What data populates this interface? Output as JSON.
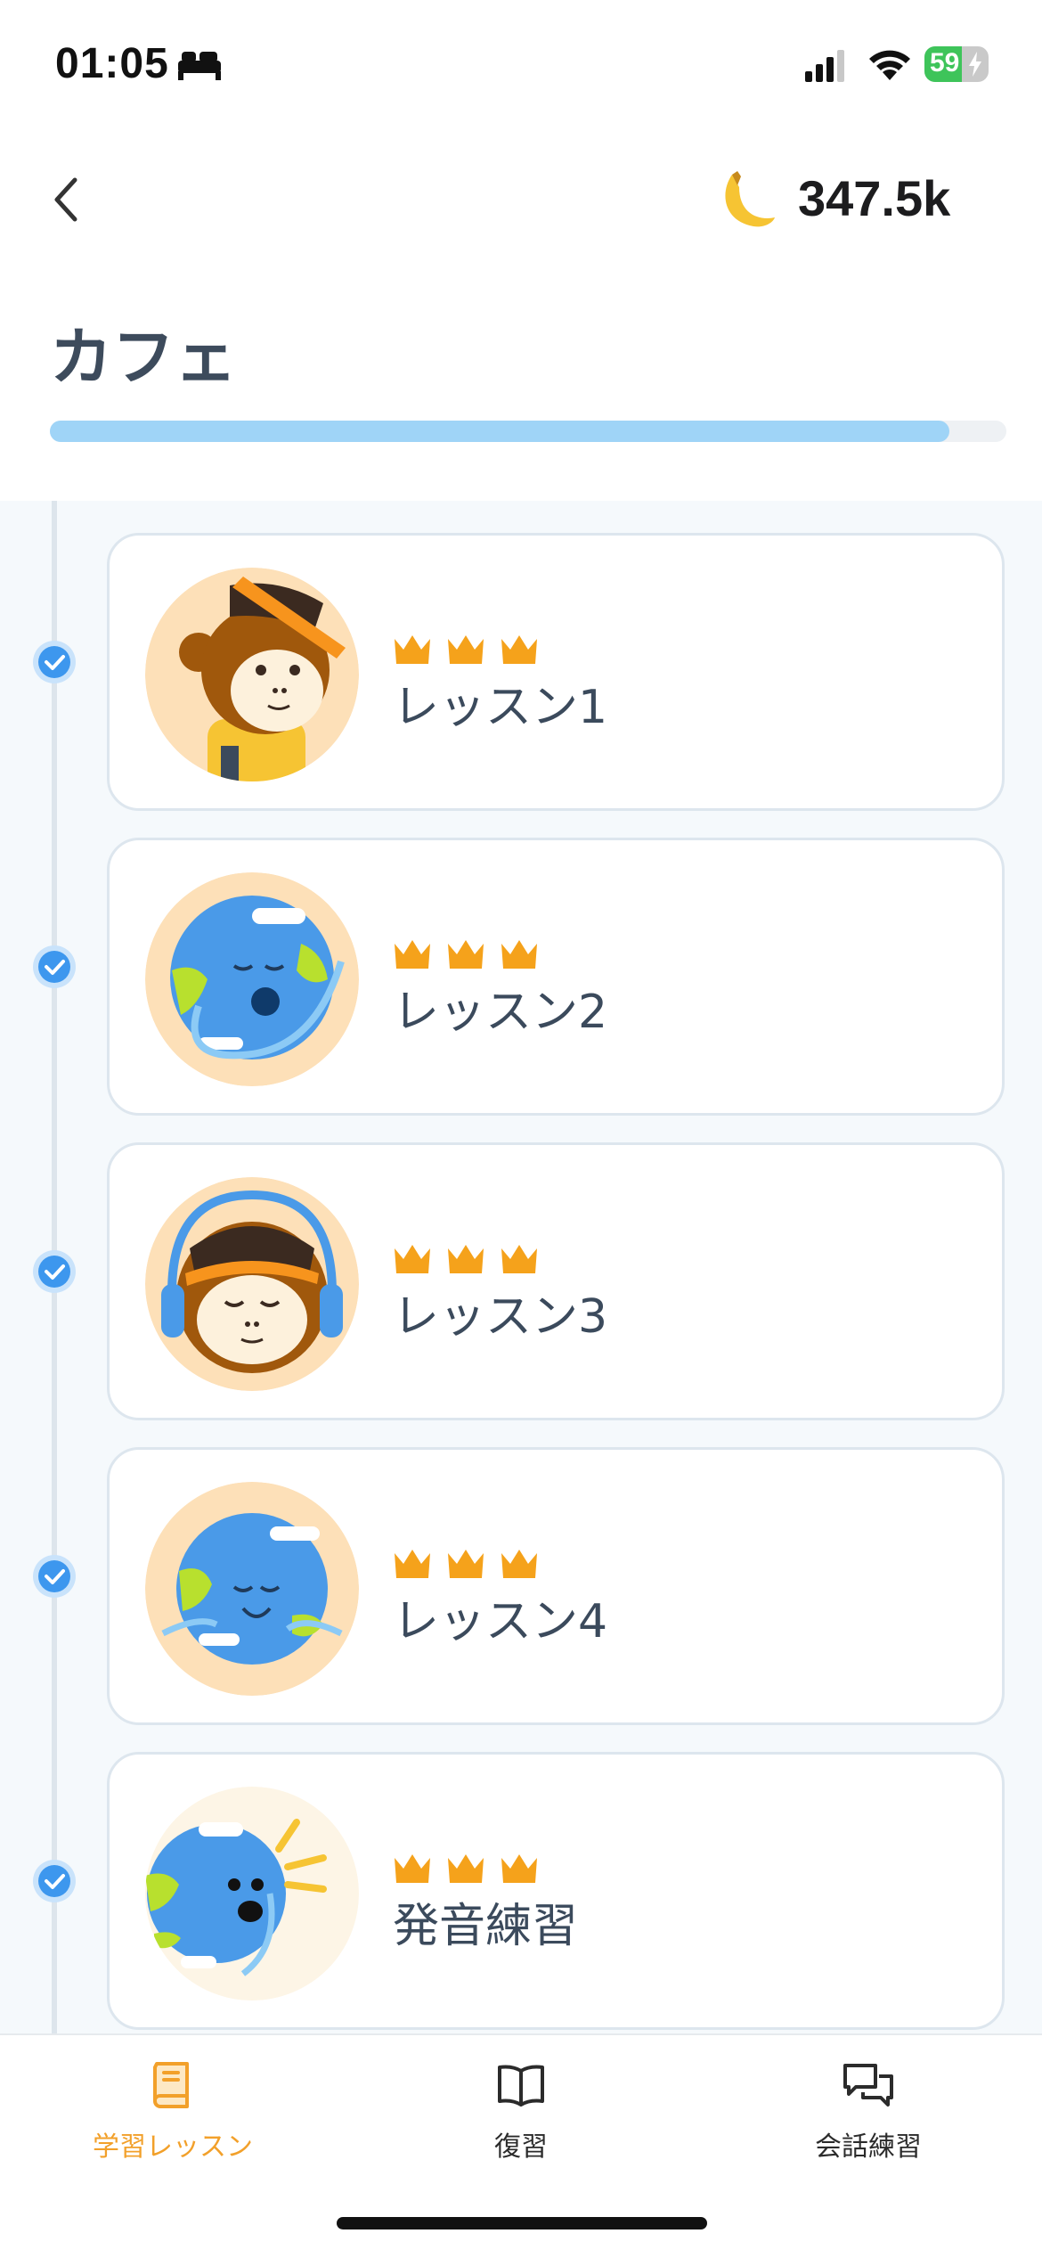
{
  "status_bar": {
    "time": "01:05",
    "battery": "59",
    "battery_level": 0.59,
    "icons": [
      "bed-icon",
      "signal-icon",
      "wifi-icon",
      "battery-icon"
    ]
  },
  "header": {
    "back_icon": "chevron-left-icon",
    "currency_icon": "banana-icon",
    "currency_count": "347.5k"
  },
  "page": {
    "title": "カフェ",
    "progress": 0.94
  },
  "lessons": [
    {
      "label": "レッスン1",
      "crowns": 3,
      "completed": true,
      "avatar": "monkey-headband"
    },
    {
      "label": "レッスン2",
      "crowns": 3,
      "completed": true,
      "avatar": "earth-singing"
    },
    {
      "label": "レッスン3",
      "crowns": 3,
      "completed": true,
      "avatar": "monkey-headphones"
    },
    {
      "label": "レッスン4",
      "crowns": 3,
      "completed": true,
      "avatar": "earth-smiling"
    },
    {
      "label": "発音練習",
      "crowns": 3,
      "completed": true,
      "avatar": "earth-talking"
    }
  ],
  "tab_bar": {
    "tabs": [
      {
        "label": "学習レッスン",
        "icon": "book-icon",
        "active": true
      },
      {
        "label": "復習",
        "icon": "open-book-icon",
        "active": false
      },
      {
        "label": "会話練習",
        "icon": "chat-bubbles-icon",
        "active": false
      }
    ]
  },
  "colors": {
    "accent": "#f2a02a",
    "progress": "#9fd4f7",
    "check": "#3d97ee",
    "crown": "#f5a21b"
  }
}
